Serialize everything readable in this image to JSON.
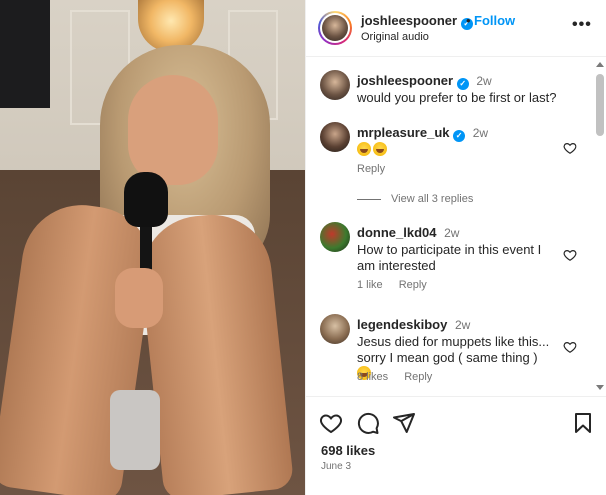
{
  "post": {
    "username": "joshleespooner",
    "follow_label": "Follow",
    "separator": "•",
    "subtitle": "Original audio",
    "more_label": "•••",
    "verified_icon": "verified-badge-icon"
  },
  "comments": [
    {
      "username": "joshleespooner",
      "verified": true,
      "time": "2w",
      "text": "would you prefer to be first or last?"
    },
    {
      "username": "mrpleasure_uk",
      "verified": true,
      "time": "2w",
      "emoji_count": 2,
      "emoji": "face-with-tears-of-joy",
      "reply_label": "Reply",
      "view_replies": "View all 3 replies"
    },
    {
      "username": "donne_lkd04",
      "verified": false,
      "time": "2w",
      "text": "How to participate in this event I am interested",
      "likes": "1 like",
      "reply_label": "Reply"
    },
    {
      "username": "legendeskiboy",
      "verified": false,
      "time": "2w",
      "text": "Jesus died for muppets like this... sorry I mean god ( same thing )",
      "trailing_emoji": "face-with-tears-of-joy",
      "likes": "8 likes",
      "reply_label": "Reply"
    }
  ],
  "actions": {
    "likes": "698 likes",
    "date": "June 3",
    "icons": [
      "heart-icon",
      "comment-icon",
      "share-icon",
      "save-icon"
    ]
  },
  "colors": {
    "accent": "#0095f6",
    "text": "#262626",
    "muted": "#737373"
  }
}
